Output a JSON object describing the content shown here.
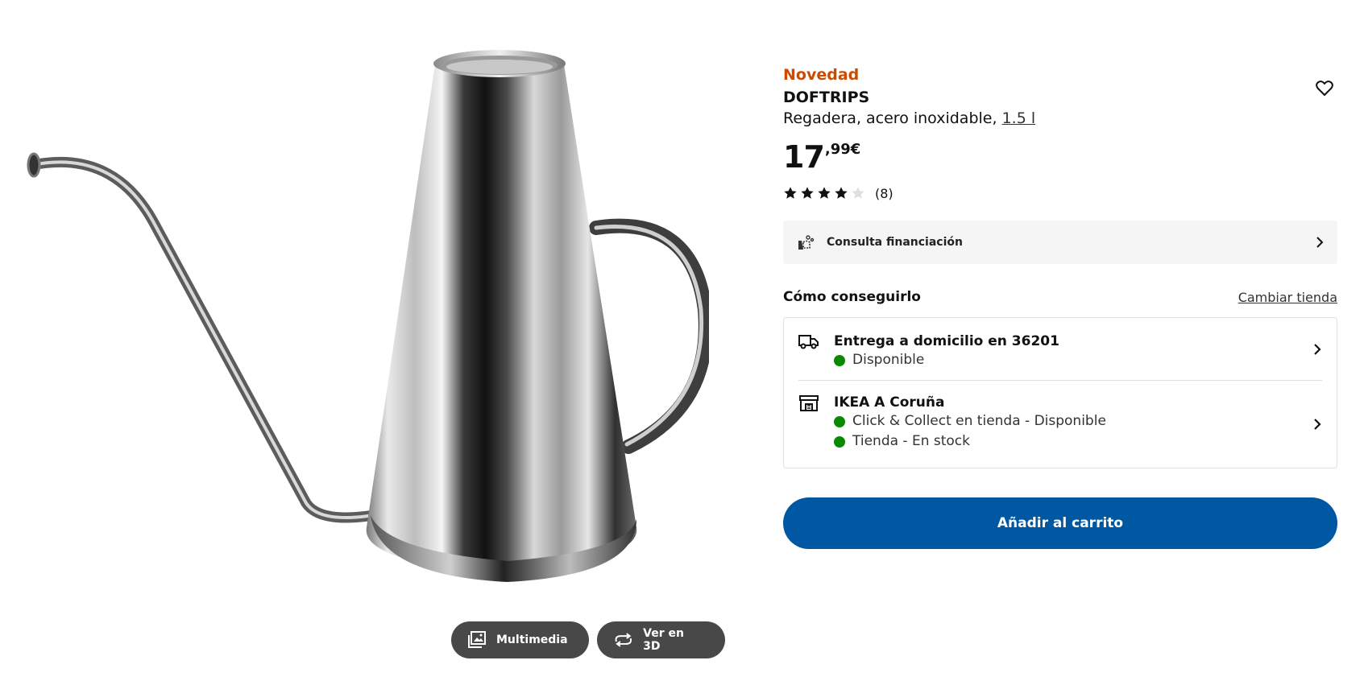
{
  "product": {
    "badge": "Novedad",
    "name": "DOFTRIPS",
    "description": "Regadera, acero inoxidable,",
    "size": "1.5 l",
    "price": {
      "integer": "17",
      "decimal": ",99€"
    },
    "rating": {
      "value": 4,
      "max": 5,
      "count_label": "(8)"
    },
    "favorite_icon": "heart-icon"
  },
  "financing": {
    "label": "Consulta financiación",
    "icon": "coins-icon"
  },
  "fulfillment": {
    "title": "Cómo conseguirlo",
    "change_store": "Cambiar tienda",
    "home_delivery": {
      "title": "Entrega a domicilio en 36201",
      "status": "Disponible",
      "icon": "truck-icon"
    },
    "store": {
      "title": "IKEA A Coruña",
      "status_click_collect": "Click & Collect en tienda - Disponible",
      "status_stock": "Tienda - En stock",
      "icon": "store-icon"
    },
    "status_color": "#0a8a00"
  },
  "cart": {
    "label": "Añadir al carrito",
    "color": "#0058a3"
  },
  "media": {
    "multimedia_label": "Multimedia",
    "view3d_label": "Ver en 3D"
  },
  "colors": {
    "accent_new": "#cc4b00",
    "pill_bg": "#484848"
  }
}
